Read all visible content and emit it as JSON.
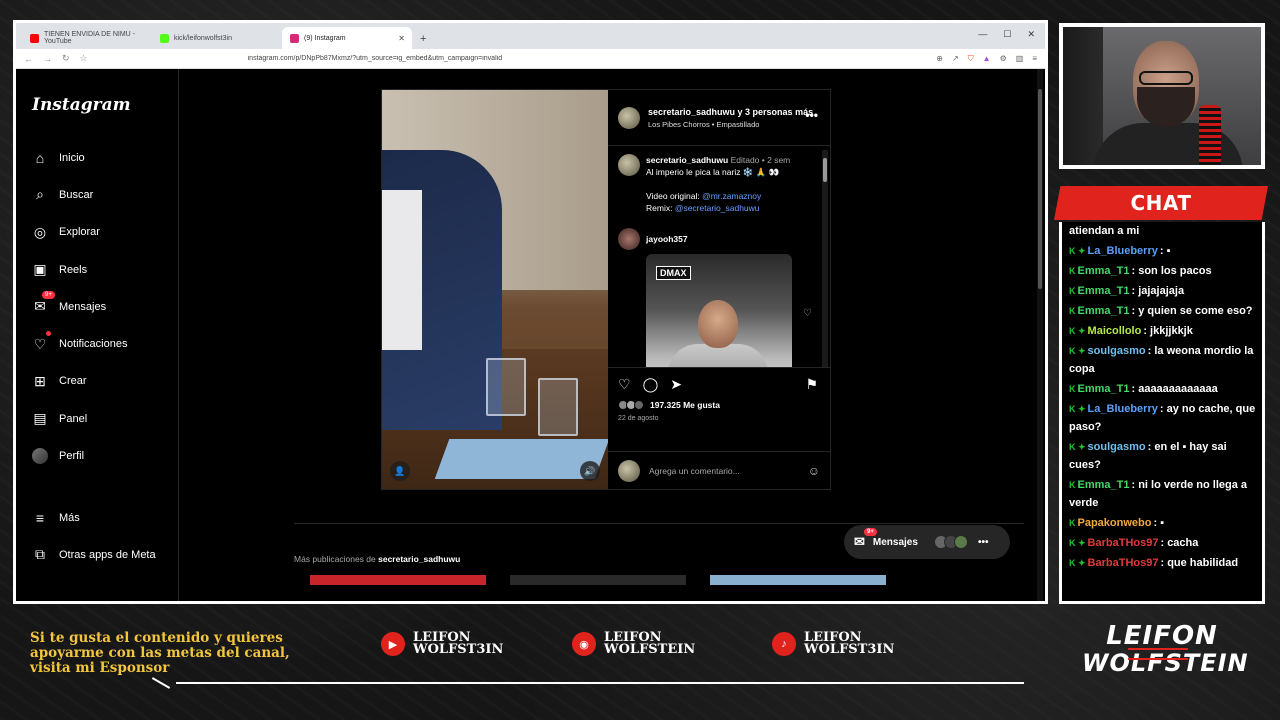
{
  "browser": {
    "tabs": [
      {
        "label": "TIENEN ENVIDIA DE NIMU - YouTube",
        "color": "#ff0000"
      },
      {
        "label": "kick/leifonwolfst3in",
        "color": "#53fc18"
      },
      {
        "label": "(9) Instagram",
        "color": "#d62976"
      }
    ],
    "url": "instagram.com/p/DNpPb87Mxmz/?utm_source=ig_embed&utm_campaign=invalid"
  },
  "instagram": {
    "logo": "Instagram",
    "nav": [
      {
        "label": "Inicio",
        "icon": "home-icon",
        "glyph": "⌂"
      },
      {
        "label": "Buscar",
        "icon": "search-icon",
        "glyph": "⌕"
      },
      {
        "label": "Explorar",
        "icon": "explore-icon",
        "glyph": "◎"
      },
      {
        "label": "Reels",
        "icon": "reels-icon",
        "glyph": "▣"
      },
      {
        "label": "Mensajes",
        "icon": "messages-icon",
        "glyph": "✉",
        "badge": "9+"
      },
      {
        "label": "Notificaciones",
        "icon": "heart-icon",
        "glyph": "♡"
      },
      {
        "label": "Crear",
        "icon": "plus-icon",
        "glyph": "⊞"
      },
      {
        "label": "Panel",
        "icon": "chart-icon",
        "glyph": "▤"
      },
      {
        "label": "Perfil",
        "icon": "avatar",
        "glyph": ""
      }
    ],
    "more_label": "Más",
    "meta_label": "Otras apps de Meta",
    "post": {
      "header_user": "secretario_sadhuwu y 3 personas más",
      "header_sub": "Los Pibes Chorros • Empastillado",
      "caption_user": "secretario_sadhuwu",
      "caption_meta": "Editado • 2 sem",
      "caption_text": "Al imperio le pica la nariz ❄️ 🙏 👀",
      "original_label": "Video original:",
      "original_link": "@mr.zamaznoy",
      "remix_label": "Remix:",
      "remix_link": "@secretario_sadhuwu",
      "commenter": "jayooh357",
      "gif_tag": "DMAX",
      "likes": "197.325 Me gusta",
      "date": "22 de agosto",
      "comment_placeholder": "Agrega un comentario..."
    },
    "more_pubs_label": "Más publicaciones de",
    "more_pubs_user": "secretario_sadhuwu",
    "messages_pill": "Mensajes",
    "messages_badge": "9+"
  },
  "chat": {
    "title": "CHAT",
    "messages": [
      {
        "badges": "",
        "user": "",
        "color": "#ffffff",
        "text": "atiendan a mi"
      },
      {
        "badges": "K ✦",
        "user": "La_Blueberry",
        "color": "#5aa0ff",
        "text": ": ▪"
      },
      {
        "badges": "K",
        "user": "Emma_T1",
        "color": "#43d96b",
        "text": ": son los pacos"
      },
      {
        "badges": "K",
        "user": "Emma_T1",
        "color": "#43d96b",
        "text": ": jajajajaja"
      },
      {
        "badges": "K",
        "user": "Emma_T1",
        "color": "#43d96b",
        "text": ": y quien se come eso?"
      },
      {
        "badges": "K ✦",
        "user": "Maicollolo",
        "color": "#b6e84a",
        "text": ": jkkjjkkjk"
      },
      {
        "badges": "K ✦",
        "user": "soulgasmo",
        "color": "#6fc0f0",
        "text": ": la weona mordio la copa"
      },
      {
        "badges": "K",
        "user": "Emma_T1",
        "color": "#43d96b",
        "text": ": aaaaaaaaaaaaa"
      },
      {
        "badges": "K ✦",
        "user": "La_Blueberry",
        "color": "#5aa0ff",
        "text": ": ay no cache, que paso?"
      },
      {
        "badges": "K ✦",
        "user": "soulgasmo",
        "color": "#6fc0f0",
        "text": ": en el ▪ hay sai cues?"
      },
      {
        "badges": "K",
        "user": "Emma_T1",
        "color": "#43d96b",
        "text": ": ni lo verde no llega a verde"
      },
      {
        "badges": "K",
        "user": "Papakonwebo",
        "color": "#f2a93b",
        "text": ": ▪"
      },
      {
        "badges": "K ✦",
        "user": "BarbaTHos97",
        "color": "#e03a3a",
        "text": ": cacha"
      },
      {
        "badges": "K ✦",
        "user": "BarbaTHos97",
        "color": "#e03a3a",
        "text": ": que habilidad"
      }
    ]
  },
  "overlay": {
    "sponsor_text": [
      "Si te gusta el contenido y quieres",
      "apoyarme con las metas del canal,",
      "visita mi Esponsor"
    ],
    "socials": [
      {
        "platform": "youtube-icon",
        "glyph": "▶",
        "line1": "LEIFON",
        "line2": "WOLFST3IN"
      },
      {
        "platform": "instagram-icon",
        "glyph": "◉",
        "line1": "LEIFON",
        "line2": "WOLFSTEIN"
      },
      {
        "platform": "tiktok-icon",
        "glyph": "♪",
        "line1": "LEIFON",
        "line2": "WOLFST3IN"
      }
    ],
    "brand_line1": "LEIFON",
    "brand_line2": "WOLFSTEIN"
  },
  "colors": {
    "accent": "#e1231e",
    "sponsor": "#f2c53d",
    "ig_link": "#6a9eff"
  }
}
